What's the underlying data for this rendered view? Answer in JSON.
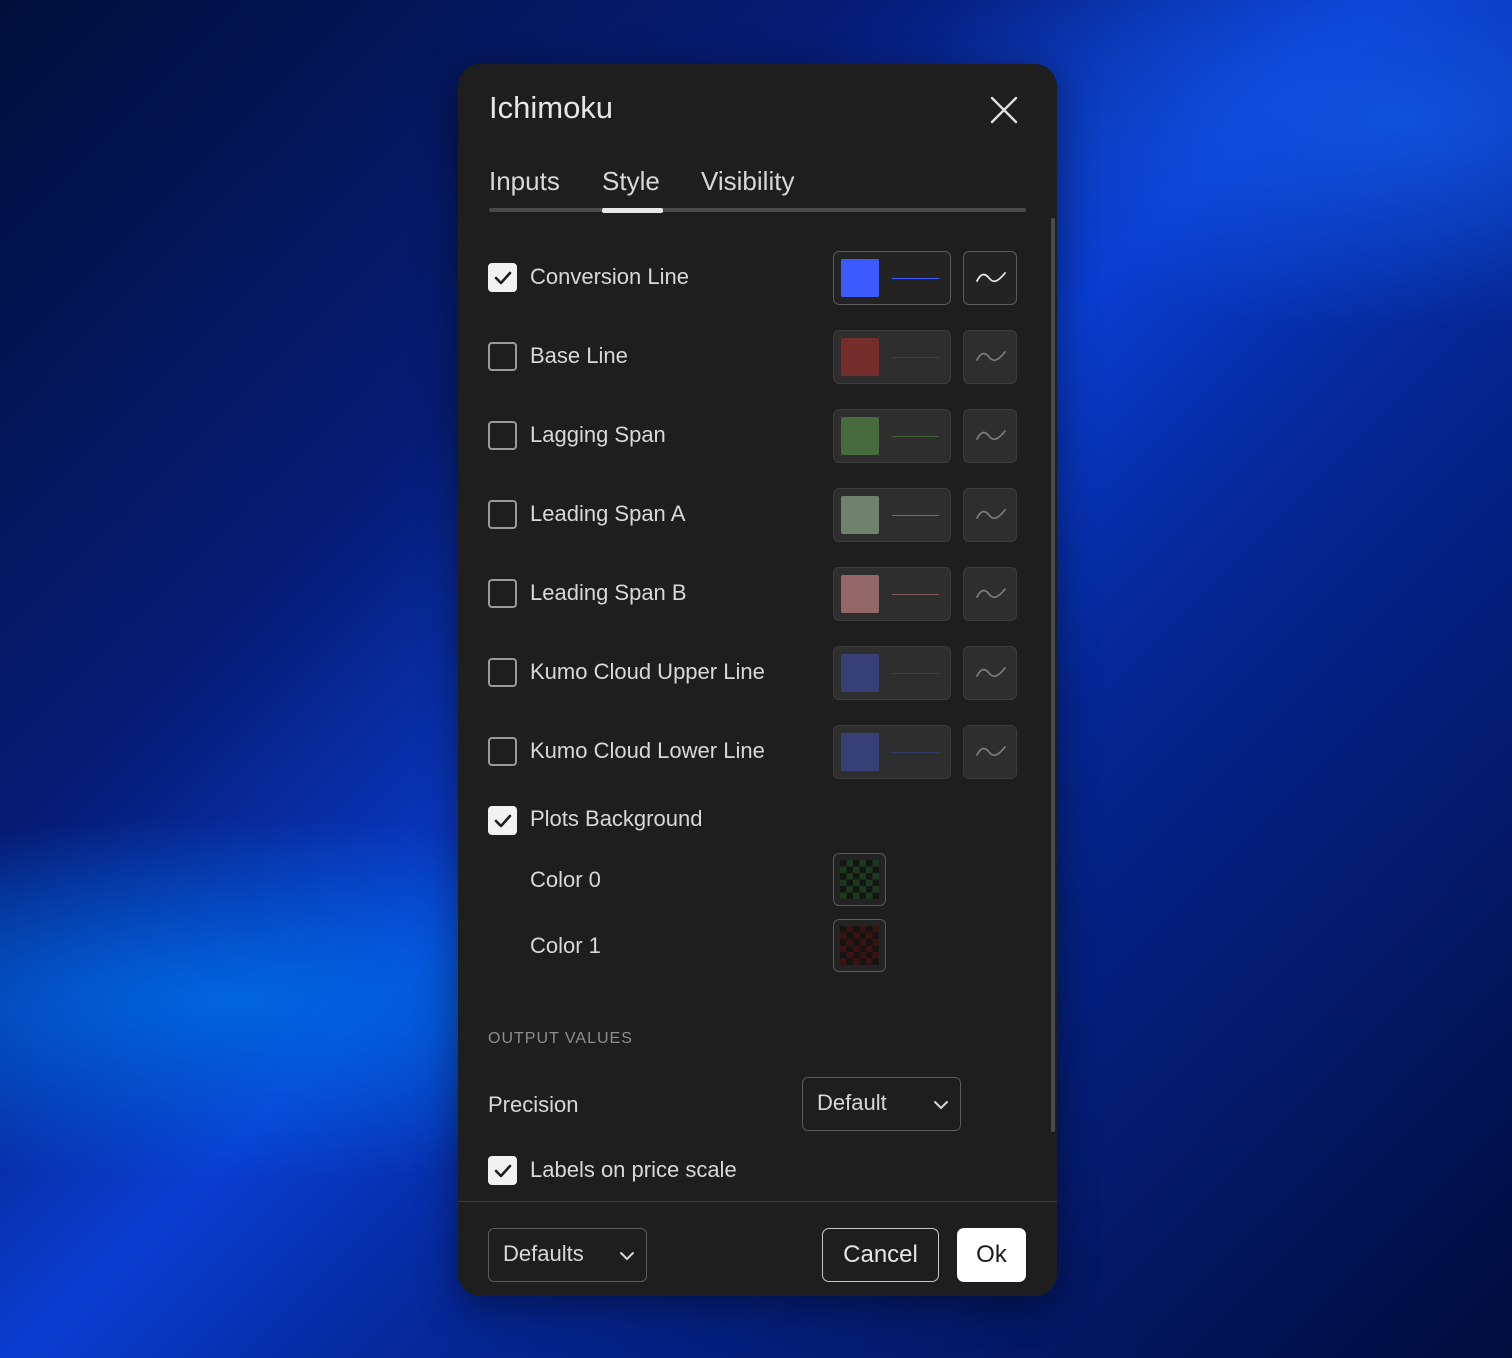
{
  "dialog": {
    "title": "Ichimoku",
    "close_icon": "close-icon"
  },
  "tabs": [
    {
      "label": "Inputs",
      "active": false
    },
    {
      "label": "Style",
      "active": true
    },
    {
      "label": "Visibility",
      "active": false
    }
  ],
  "plots": [
    {
      "label": "Conversion Line",
      "checked": true,
      "color": "#3d5afe"
    },
    {
      "label": "Base Line",
      "checked": false,
      "color": "#b2302c"
    },
    {
      "label": "Lagging Span",
      "checked": false,
      "color": "#5a9e4a"
    },
    {
      "label": "Leading Span A",
      "checked": false,
      "color": "#a5c9a1"
    },
    {
      "label": "Leading Span B",
      "checked": false,
      "color": "#e89898"
    },
    {
      "label": "Kumo Cloud Upper Line",
      "checked": false,
      "color": "#3f51b5"
    },
    {
      "label": "Kumo Cloud Lower Line",
      "checked": false,
      "color": "#3f51b5"
    }
  ],
  "plots_background": {
    "label": "Plots Background",
    "checked": true,
    "colors": [
      {
        "label": "Color 0",
        "color": "#1b3a1b"
      },
      {
        "label": "Color 1",
        "color": "#3a1212"
      }
    ]
  },
  "output_values": {
    "section_title": "OUTPUT VALUES",
    "precision_label": "Precision",
    "precision_value": "Default",
    "labels_on_price_scale": {
      "label": "Labels on price scale",
      "checked": true
    }
  },
  "footer": {
    "defaults_label": "Defaults",
    "cancel_label": "Cancel",
    "ok_label": "Ok"
  }
}
